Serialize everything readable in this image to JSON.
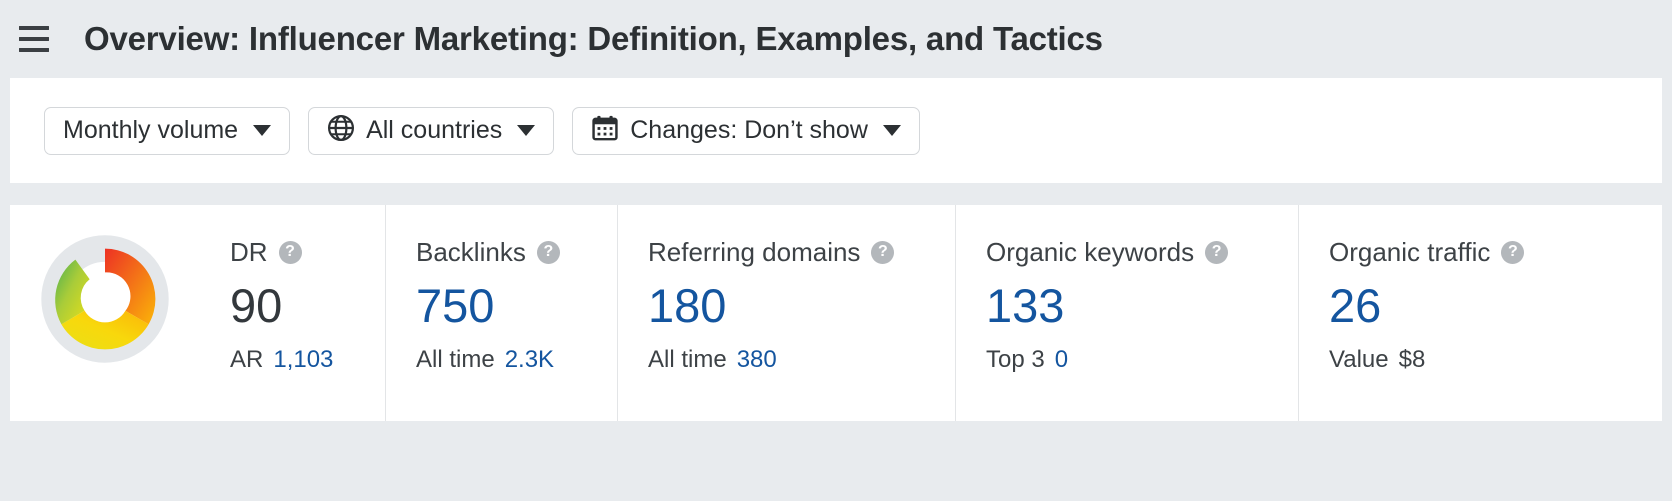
{
  "header": {
    "menu_icon": "hamburger-menu-icon",
    "title": "Overview: Influencer Marketing: Definition, Examples, and Tactics"
  },
  "filters": [
    {
      "id": "monthly-volume",
      "label": "Monthly volume",
      "icon": null,
      "caret": true
    },
    {
      "id": "all-countries",
      "label": "All countries",
      "icon": "globe-icon",
      "caret": true
    },
    {
      "id": "changes",
      "label": "Changes: Don’t show",
      "icon": "calendar-icon",
      "caret": true
    }
  ],
  "donut": {
    "name": "domain-rating-donut-chart",
    "value": 90,
    "max": 100,
    "track_color": "#e4e7ea",
    "gradient_stops": [
      "#ed3124",
      "#f26522",
      "#f99a10",
      "#fbc707",
      "#f5e51c",
      "#a8cc3a",
      "#4caf50"
    ]
  },
  "metrics": [
    {
      "id": "dr",
      "label": "DR",
      "help_icon": "question-mark-icon",
      "value": "90",
      "value_color": "dark",
      "sub_label": "AR",
      "sub_value": "1,103",
      "sub_value_color": "blue"
    },
    {
      "id": "backlinks",
      "label": "Backlinks",
      "help_icon": "question-mark-icon",
      "value": "750",
      "value_color": "blue",
      "sub_label": "All time",
      "sub_value": "2.3K",
      "sub_value_color": "blue"
    },
    {
      "id": "referring-domains",
      "label": "Referring domains",
      "help_icon": "question-mark-icon",
      "value": "180",
      "value_color": "blue",
      "sub_label": "All time",
      "sub_value": "380",
      "sub_value_color": "blue"
    },
    {
      "id": "organic-keywords",
      "label": "Organic keywords",
      "help_icon": "question-mark-icon",
      "value": "133",
      "value_color": "blue",
      "sub_label": "Top 3",
      "sub_value": "0",
      "sub_value_color": "blue"
    },
    {
      "id": "organic-traffic",
      "label": "Organic traffic",
      "help_icon": "question-mark-icon",
      "value": "26",
      "value_color": "blue",
      "sub_label": "Value",
      "sub_value": "$8",
      "sub_value_color": "dark"
    }
  ],
  "colors": {
    "page_background": "#e8ebee",
    "card_background": "#ffffff",
    "link_blue": "#14559f",
    "text_dark": "#2c3033",
    "divider": "#e3e5e7"
  }
}
